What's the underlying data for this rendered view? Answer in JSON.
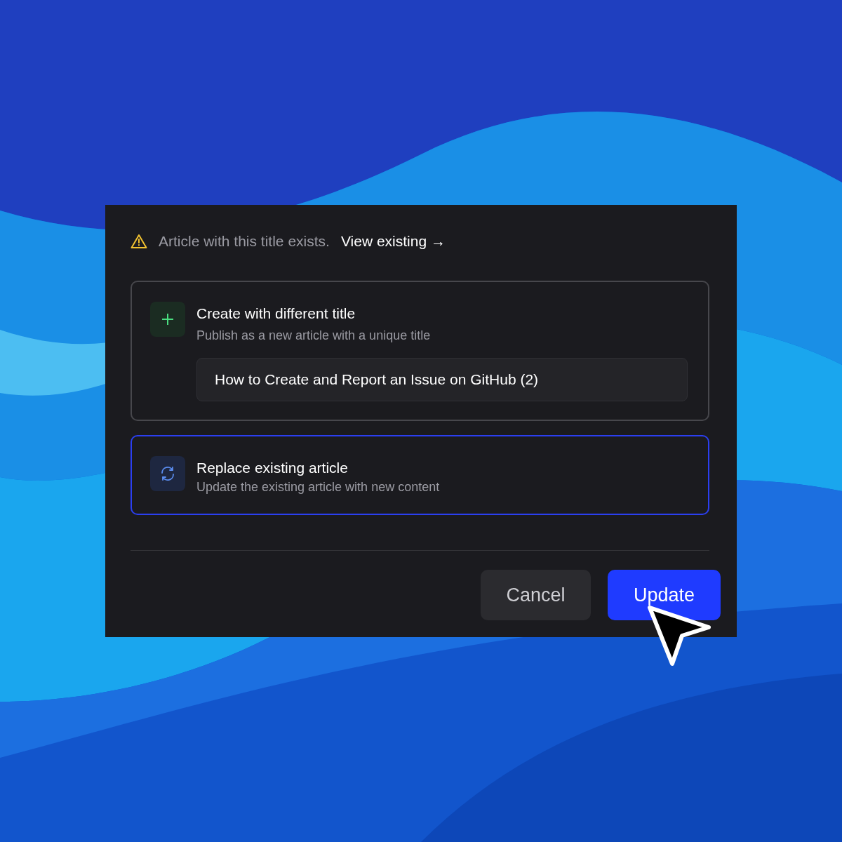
{
  "warning": {
    "message": "Article with this title exists.",
    "link": "View existing →"
  },
  "options": [
    {
      "kind": "new-title",
      "title": "Create with different title",
      "subtitle": "Publish as a new article with a unique title",
      "value": "How to Create and Report an Issue on GitHub (2)",
      "selected": false
    },
    {
      "kind": "replace",
      "title": "Replace existing article",
      "subtitle": "Update the existing article with new content",
      "selected": true
    }
  ],
  "buttons": [
    {
      "label": "Cancel",
      "kind": "secondary"
    },
    {
      "label": "Update",
      "kind": "primary"
    }
  ]
}
